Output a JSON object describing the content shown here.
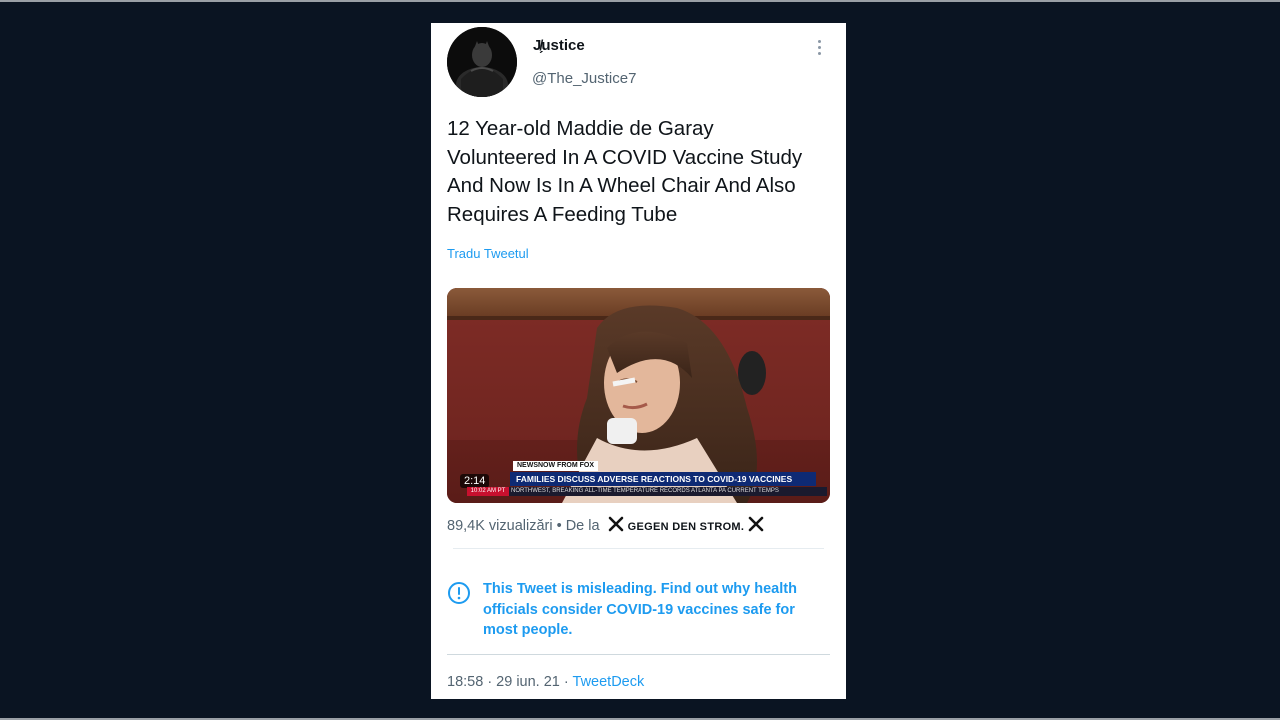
{
  "tweet": {
    "display_name": "J̸̗ustice",
    "handle": "@The_Justice7",
    "text": "12 Year-old Maddie de Garay Volunteered In A COVID Vaccine Study And Now Is In A Wheel Chair And Also Requires A Feeding Tube",
    "translate_label": "Tradu Tweetul",
    "video": {
      "duration": "2:14",
      "ticker_source": "NEWSNOW FROM FOX",
      "ticker_headline": "FAMILIES DISCUSS ADVERSE REACTIONS TO COVID-19 VACCINES",
      "ticker_crawl": "NORTHWEST, BREAKING ALL-TIME TEMPERATURE RECORDS    ATLANTA  PA  CURRENT TEMPS",
      "ticker_time": "10:02 AM PT"
    },
    "views": "89,4K vizualizări",
    "source_prefix": "• De la",
    "source_name": "GEGEN DEN STROM.",
    "warning": "This Tweet is misleading. Find out why health officials consider COVID-19 vaccines safe for most people.",
    "timestamp": "18:58 · 29 iun. 21 ·",
    "client": "TweetDeck"
  },
  "icons": {
    "more": "more-vertical-icon",
    "info": "info-circle-icon",
    "x": "x-mark-icon"
  },
  "colors": {
    "background": "#0a1422",
    "link": "#1d9bf0",
    "secondary_text": "#536471"
  }
}
